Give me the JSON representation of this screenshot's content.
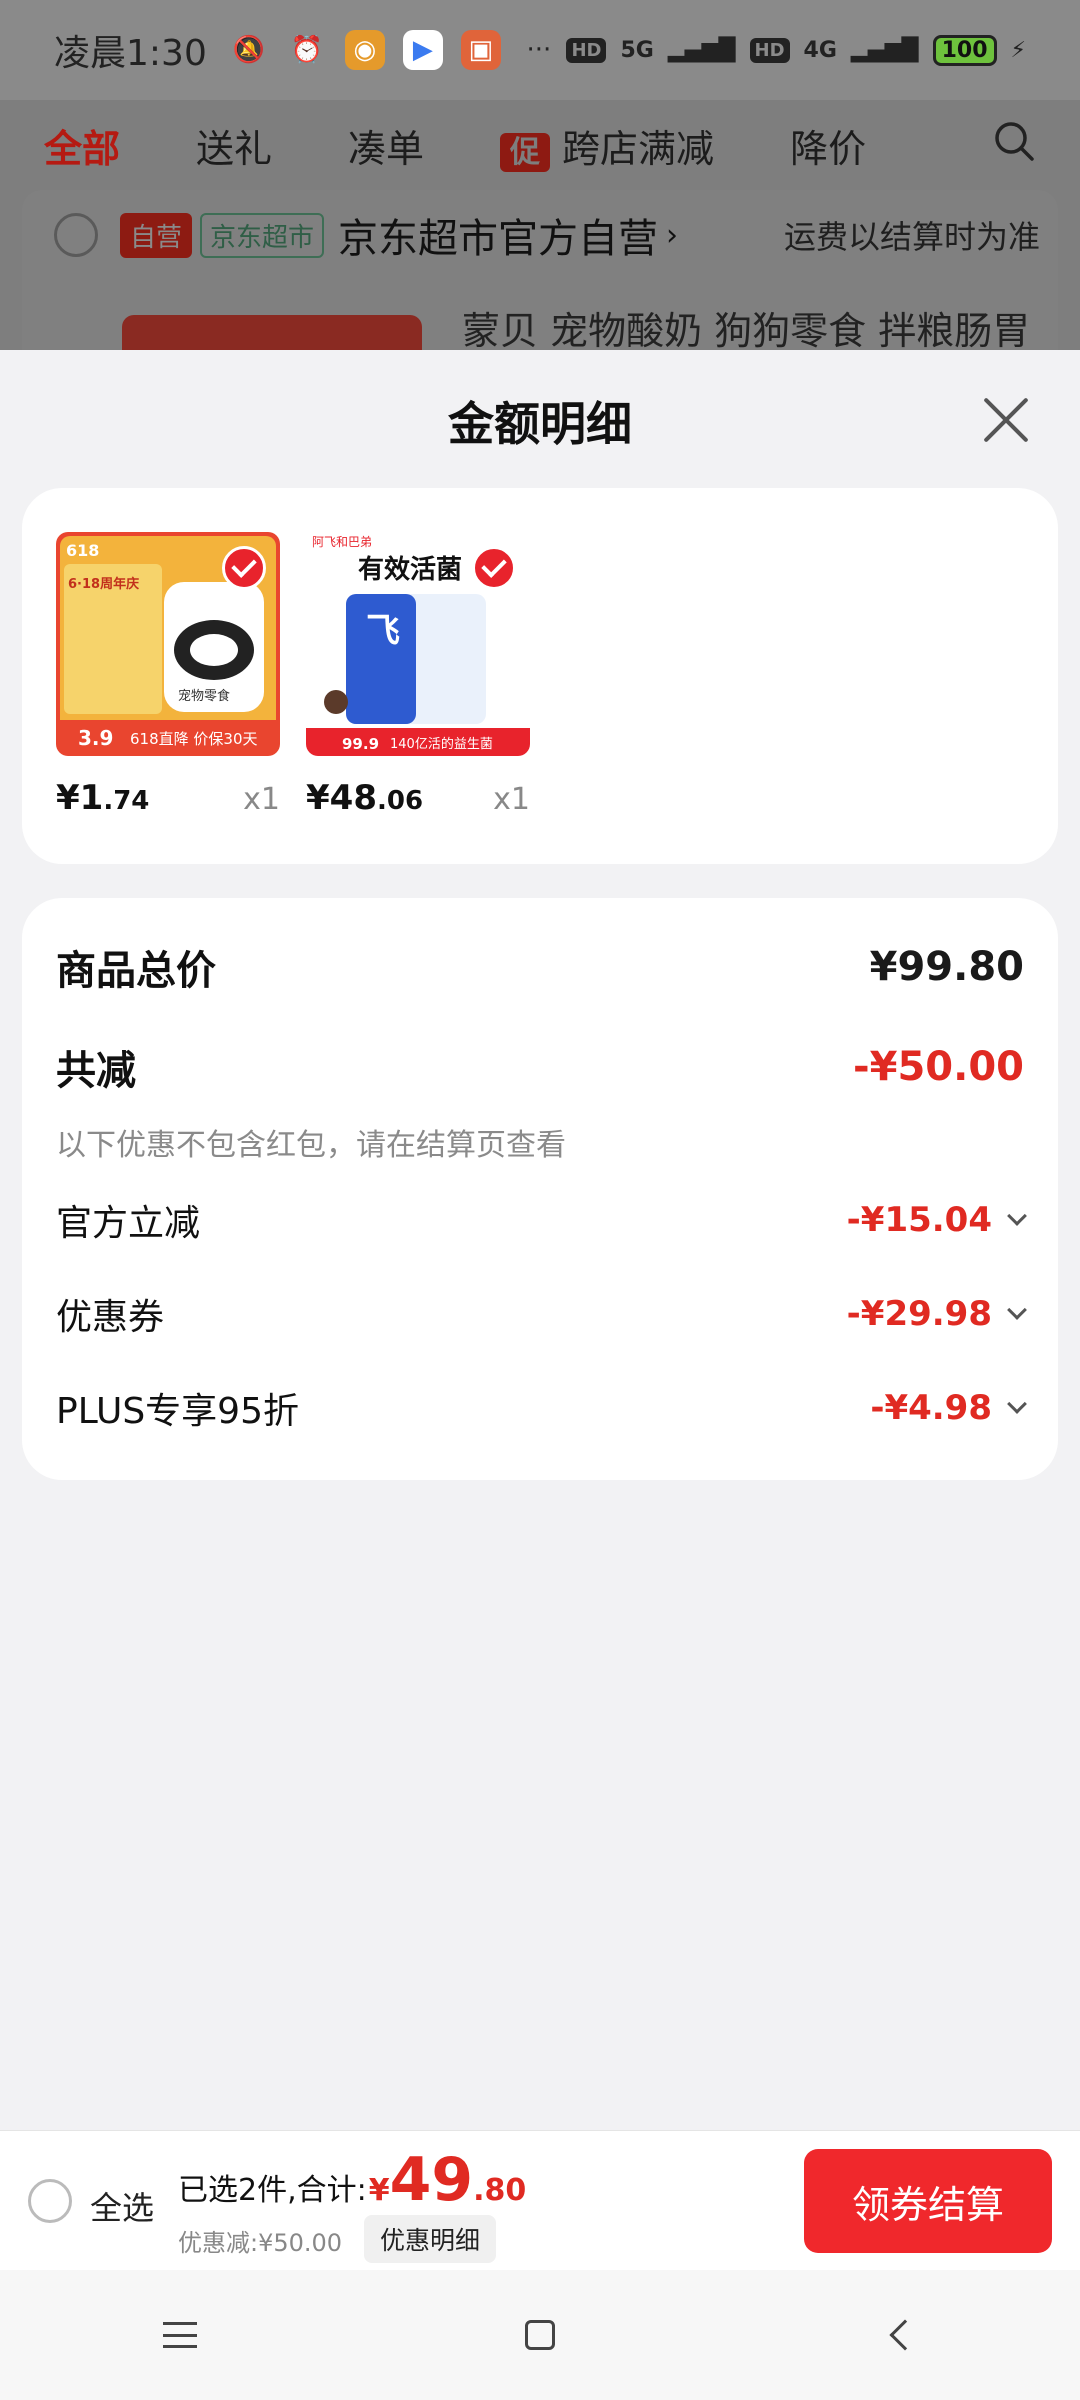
{
  "status_bar": {
    "time": "凌晨1:30",
    "network_1": "5G",
    "network_2": "4G",
    "hd_1": "HD",
    "hd_2": "HD",
    "battery": "100",
    "icons": [
      "mute-bell-icon",
      "alarm-icon",
      "weibo-icon",
      "video-app-icon",
      "shop-app-icon",
      "more-dots-icon",
      "signal-icon",
      "charging-icon"
    ],
    "more": "···"
  },
  "tabs": {
    "items": [
      "全部",
      "送礼",
      "凑单",
      "跨店满减",
      "降价"
    ],
    "promo_badge": "促"
  },
  "store": {
    "tag_self": "自营",
    "tag_supermarket": "京东超市",
    "name": "京东超市官方自营",
    "arrow": "›",
    "shipping_note": "运费以结算时为准",
    "product_title": "蒙贝 宠物酸奶 狗狗零食 拌粮肠胃"
  },
  "sheet": {
    "title": "金额明细",
    "products": [
      {
        "price_int": "¥1",
        "price_dec": ".74",
        "qty": "x1",
        "img_text": [
          "618",
          "6·18周年庆",
          "宠物零食",
          "3.9",
          "618直降 价保30天"
        ],
        "colors": {
          "bg": "#f3b33c",
          "frame": "#e9452f"
        }
      },
      {
        "price_int": "¥48",
        "price_dec": ".06",
        "qty": "x1",
        "img_text": [
          "阿飞和巴弟",
          "有效活菌",
          "99.9",
          "140亿活的益生菌"
        ],
        "colors": {
          "bg": "#ffffff",
          "frame": "#e8232c"
        }
      }
    ],
    "summary": {
      "total_label": "商品总价",
      "total_value": "¥99.80",
      "reduction_label": "共减",
      "reduction_value": "-¥50.00",
      "note": "以下优惠不包含红包，请在结算页查看",
      "items": [
        {
          "label": "官方立减",
          "value": "-¥15.04"
        },
        {
          "label": "优惠券",
          "value": "-¥29.98"
        },
        {
          "label": "PLUS专享95折",
          "value": "-¥4.98"
        }
      ]
    }
  },
  "bottom_bar": {
    "select_all": "全选",
    "selected_text": "已选2件,合计:",
    "yen": "¥",
    "total_int": "49",
    "total_dec": ".80",
    "discount": "优惠减:¥50.00",
    "detail_button": "优惠明细",
    "checkout_button": "领券结算"
  },
  "nav": {
    "icons": [
      "menu-icon",
      "home-icon",
      "back-icon"
    ]
  },
  "colors": {
    "accent_red": "#e02a22",
    "checkout_red": "#f0282c",
    "dim_overlay": "#7e7e7e"
  }
}
